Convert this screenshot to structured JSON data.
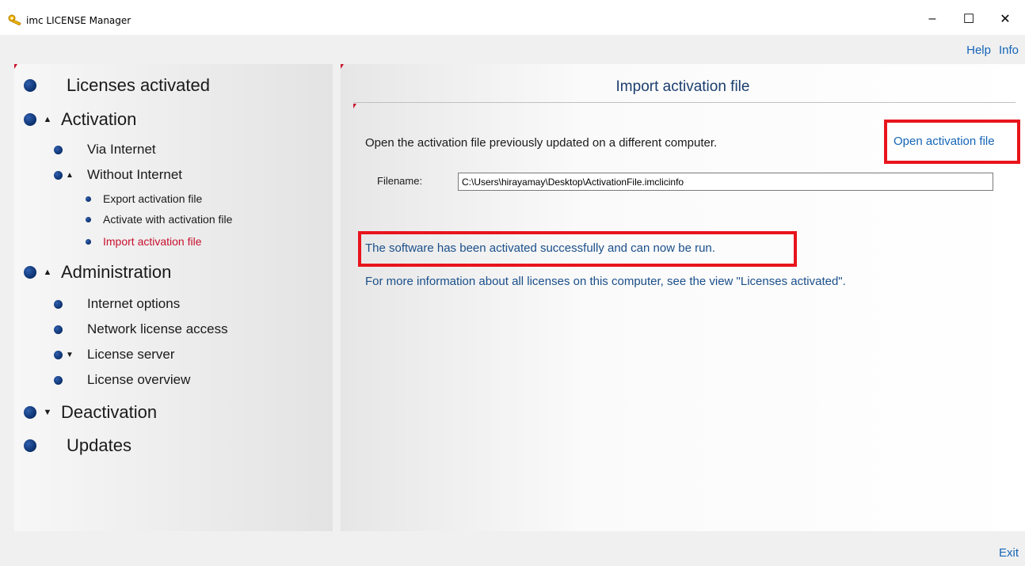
{
  "window": {
    "title": "imc LICENSE Manager",
    "minimize_glyph": "–",
    "maximize_glyph": "☐",
    "close_glyph": "✕"
  },
  "header_links": {
    "help": "Help",
    "info": "Info"
  },
  "nav": {
    "licenses_activated": "Licenses activated",
    "activation": "Activation",
    "via_internet": "Via Internet",
    "without_internet": "Without Internet",
    "export_activation_file": "Export activation file",
    "activate_with_activation_file": "Activate with activation file",
    "import_activation_file": "Import activation file",
    "administration": "Administration",
    "internet_options": "Internet options",
    "network_license_access": "Network license access",
    "license_server": "License server",
    "license_overview": "License overview",
    "deactivation": "Deactivation",
    "updates": "Updates",
    "arrow_up": "▲",
    "arrow_down": "▼"
  },
  "content": {
    "title": "Import activation file",
    "description": "Open the activation file previously updated on a different computer.",
    "open_link": "Open activation file",
    "filename_label": "Filename:",
    "filename_value": "C:\\Users\\hirayamay\\Desktop\\ActivationFile.imclicinfo",
    "success_message": "The software has been activated successfully and can now be run.",
    "more_info": "For more information about all licenses on this computer, see the view \"Licenses activated\"."
  },
  "footer": {
    "exit": "Exit"
  },
  "colors": {
    "accent_red": "#c8102e",
    "link_blue": "#1565b8",
    "highlight_red": "#e8141c"
  }
}
